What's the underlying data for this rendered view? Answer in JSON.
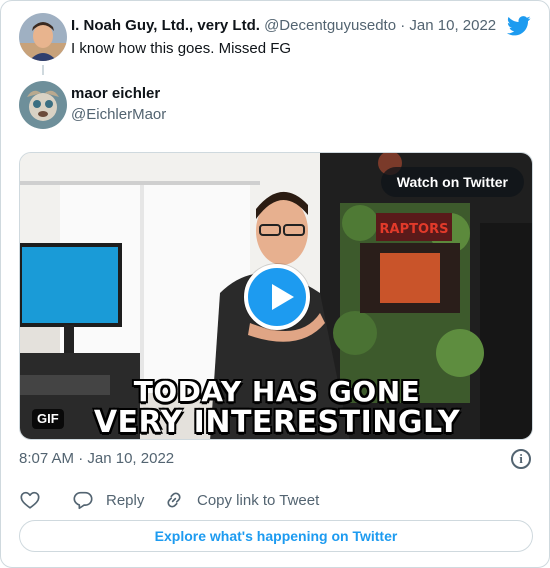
{
  "parent_tweet": {
    "name": "I. Noah Guy, Ltd., very Ltd.",
    "handle": "@Decentguyusedto",
    "separator": "·",
    "date": "Jan 10, 2022",
    "text": "I know how this goes. Missed FG"
  },
  "author": {
    "name": "maor eichler",
    "handle": "@EichlerMaor"
  },
  "media": {
    "watch_label": "Watch on Twitter",
    "gif_label": "GIF",
    "caption_line1": "TODAY HAS GONE",
    "caption_line2": "VERY INTERESTINGLY",
    "sign_text": "RAPTORS"
  },
  "timestamp": {
    "time": "8:07 AM",
    "separator": "·",
    "date": "Jan 10, 2022"
  },
  "actions": {
    "like_icon": "heart-icon",
    "reply_label": "Reply",
    "copy_label": "Copy link to Tweet"
  },
  "explore_label": "Explore what's happening on Twitter",
  "colors": {
    "accent": "#1d9bf0",
    "secondary_text": "#536471",
    "border": "#cfd9de"
  }
}
